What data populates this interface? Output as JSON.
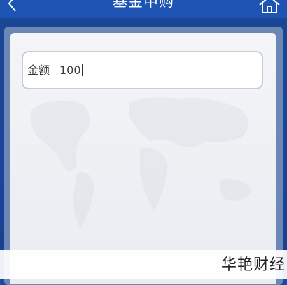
{
  "header": {
    "title": "基金申购",
    "back_icon": "chevron-left-icon",
    "home_icon": "home-icon",
    "background_color": "#1e55b4"
  },
  "form": {
    "amount_label": "金额",
    "amount_value": "100"
  },
  "watermark": {
    "text": "华艳财经"
  }
}
